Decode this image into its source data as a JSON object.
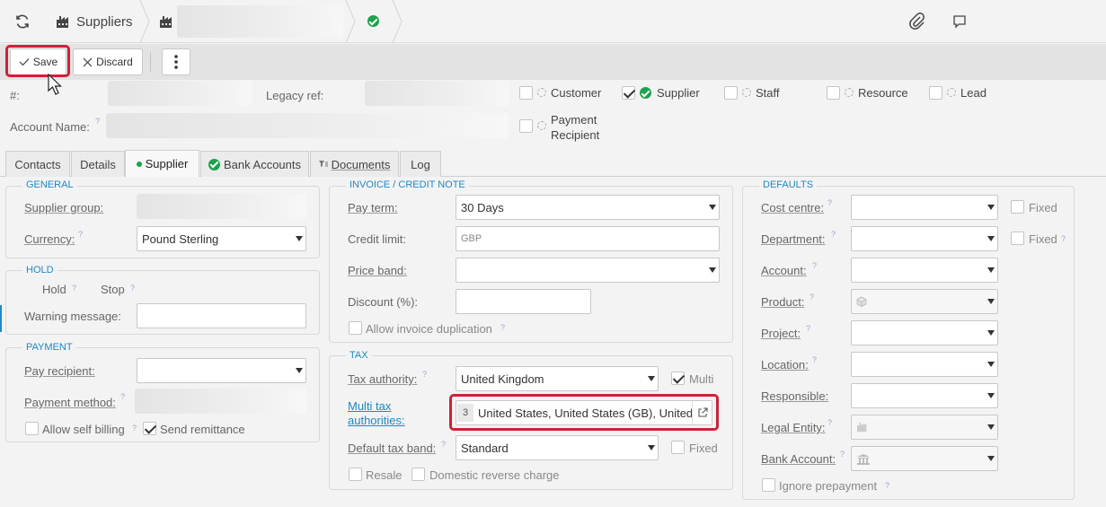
{
  "topbar": {
    "suppliers_label": "Suppliers"
  },
  "toolbar": {
    "save_label": "Save",
    "discard_label": "Discard"
  },
  "header": {
    "number_label": "#:",
    "legacy_ref_label": "Legacy ref:",
    "account_name_label": "Account Name:",
    "roles": [
      {
        "label": "Customer",
        "checked": false
      },
      {
        "label": "Supplier",
        "checked": true
      },
      {
        "label": "Staff",
        "checked": false
      },
      {
        "label": "Resource",
        "checked": false
      },
      {
        "label": "Lead",
        "checked": false
      }
    ],
    "payment_recipient_line1": "Payment",
    "payment_recipient_line2": "Recipient"
  },
  "tabs": [
    "Contacts",
    "Details",
    "Supplier",
    "Bank Accounts",
    "Documents",
    "Log"
  ],
  "general": {
    "title": "GENERAL",
    "supplier_group_label": "Supplier group:",
    "currency_label": "Currency:",
    "currency_value": "Pound Sterling"
  },
  "hold": {
    "title": "HOLD",
    "hold_label": "Hold",
    "stop_label": "Stop",
    "warning_label": "Warning message:"
  },
  "payment": {
    "title": "PAYMENT",
    "pay_recipient_label": "Pay recipient:",
    "payment_method_label": "Payment method:",
    "allow_self_billing_label": "Allow self billing",
    "send_remittance_label": "Send remittance"
  },
  "invoice": {
    "title": "INVOICE / CREDIT NOTE",
    "pay_term_label": "Pay term:",
    "pay_term_value": "30 Days",
    "credit_limit_label": "Credit limit:",
    "credit_limit_placeholder": "GBP",
    "price_band_label": "Price band:",
    "discount_label": "Discount (%):",
    "allow_dup_label": "Allow invoice duplication"
  },
  "tax": {
    "title": "TAX",
    "authority_label": "Tax authority:",
    "authority_value": "United Kingdom",
    "multi_label": "Multi",
    "multi_tax_label1": "Multi tax",
    "multi_tax_label2": "authorities:",
    "multi_count": "3",
    "multi_value": "United States, United States (GB), United K",
    "default_band_label": "Default tax band:",
    "default_band_value": "Standard",
    "fixed_label": "Fixed",
    "resale_label": "Resale",
    "domestic_label": "Domestic reverse charge"
  },
  "defaults": {
    "title": "DEFAULTS",
    "cost_centre_label": "Cost centre:",
    "department_label": "Department:",
    "account_label": "Account:",
    "product_label": "Product:",
    "project_label": "Project:",
    "location_label": "Location:",
    "responsible_label": "Responsible:",
    "legal_entity_label": "Legal Entity:",
    "bank_account_label": "Bank Account:",
    "fixed_label": "Fixed",
    "ignore_prepayment_label": "Ignore prepayment"
  },
  "colors": {
    "accent": "#1e88c7",
    "highlight": "#d11f38",
    "success": "#1aa34a"
  }
}
